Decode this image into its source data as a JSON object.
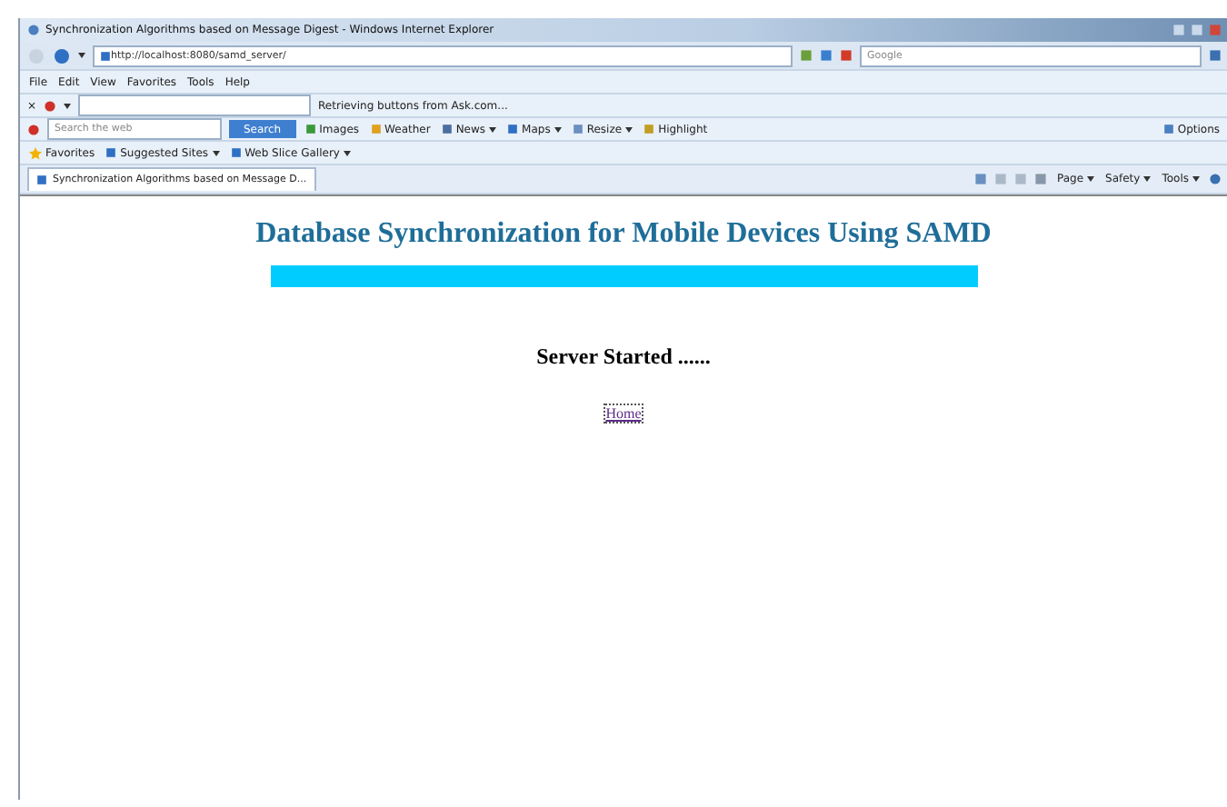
{
  "window": {
    "title": "Synchronization Algorithms based on Message Digest - Windows Internet Explorer"
  },
  "address_bar": {
    "url": "http://localhost:8080/samd_server/"
  },
  "search_box": {
    "placeholder": "Google"
  },
  "menu": [
    "File",
    "Edit",
    "View",
    "Favorites",
    "Tools",
    "Help"
  ],
  "ask_bar": {
    "close": "×",
    "status": "Retrieving buttons from Ask.com..."
  },
  "search_toolbar": {
    "placeholder": "Search the web",
    "button": "Search",
    "items": [
      {
        "label": "Images",
        "menu": false
      },
      {
        "label": "Weather",
        "menu": false
      },
      {
        "label": "News",
        "menu": true
      },
      {
        "label": "Maps",
        "menu": true
      },
      {
        "label": "Resize",
        "menu": true
      },
      {
        "label": "Highlight",
        "menu": false
      }
    ],
    "options": "Options"
  },
  "favorites_bar": {
    "favorites": "Favorites",
    "items": [
      {
        "label": "Suggested Sites",
        "menu": true
      },
      {
        "label": "Web Slice Gallery",
        "menu": true
      }
    ]
  },
  "tabs": [
    {
      "label": "Synchronization Algorithms based on Message D...",
      "selected": true
    }
  ],
  "command_bar": [
    "Page",
    "Safety",
    "Tools"
  ],
  "page": {
    "heading": "Database Synchronization for Mobile Devices Using SAMD",
    "status": "Server Started ......",
    "link": "Home"
  }
}
